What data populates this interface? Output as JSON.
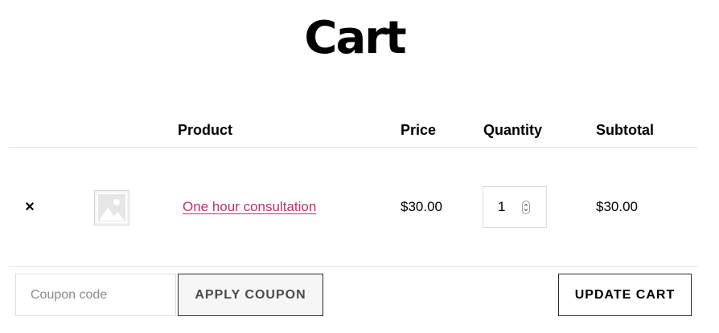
{
  "page": {
    "title": "Cart"
  },
  "table": {
    "headers": {
      "product": "Product",
      "price": "Price",
      "quantity": "Quantity",
      "subtotal": "Subtotal"
    },
    "rows": [
      {
        "remove_glyph": "×",
        "thumbnail_icon": "placeholder-image-icon",
        "product": "One hour consultation",
        "price": "$30.00",
        "quantity": "1",
        "subtotal": "$30.00"
      }
    ]
  },
  "actions": {
    "coupon_placeholder": "Coupon code",
    "apply_coupon_label": "APPLY COUPON",
    "update_cart_label": "UPDATE CART"
  },
  "colors": {
    "link": "#c1306b",
    "border": "#dcdcdc",
    "divider": "#e5e5e5",
    "apply_button_bg": "#f6f6f6"
  }
}
